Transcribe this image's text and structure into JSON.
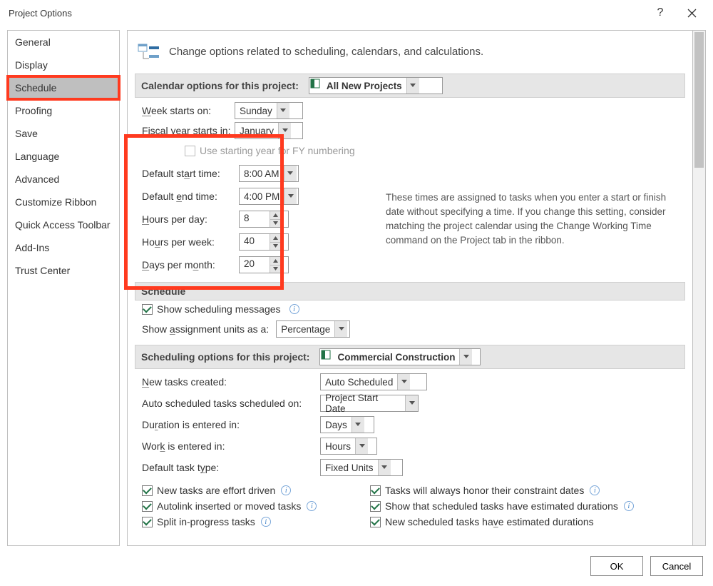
{
  "title": "Project Options",
  "sidebar": {
    "items": [
      {
        "label": "General"
      },
      {
        "label": "Display"
      },
      {
        "label": "Schedule"
      },
      {
        "label": "Proofing"
      },
      {
        "label": "Save"
      },
      {
        "label": "Language"
      },
      {
        "label": "Advanced"
      },
      {
        "label": "Customize Ribbon"
      },
      {
        "label": "Quick Access Toolbar"
      },
      {
        "label": "Add-Ins"
      },
      {
        "label": "Trust Center"
      }
    ],
    "selected": "Schedule"
  },
  "intro": "Change options related to scheduling, calendars, and calculations.",
  "section_calendar": {
    "title": "Calendar options for this project:",
    "project_select": "All New Projects",
    "week_starts_label": "Week starts on:",
    "week_starts": "Sunday",
    "fiscal_starts_label": "Fiscal year starts in:",
    "fiscal_starts": "January",
    "use_starting_year": "Use starting year for FY numbering",
    "default_start_label": "Default start time:",
    "default_start": "8:00 AM",
    "default_end_label": "Default end time:",
    "default_end": "4:00 PM",
    "hours_day_label": "Hours per day:",
    "hours_day": "8",
    "hours_week_label": "Hours per week:",
    "hours_week": "40",
    "days_month_label": "Days per month:",
    "days_month": "20",
    "help": "These times are assigned to tasks when you enter a start or finish date without specifying a time. If you change this setting, consider matching the project calendar using the Change Working Time command on the Project tab in the ribbon."
  },
  "section_schedule": {
    "title": "Schedule",
    "show_msgs": "Show scheduling messages",
    "assign_units_label": "Show assignment units as a:",
    "assign_units": "Percentage"
  },
  "section_schedopt": {
    "title": "Scheduling options for this project:",
    "project_select": "Commercial Construction",
    "new_tasks_label": "New tasks created:",
    "new_tasks": "Auto Scheduled",
    "auto_on_label": "Auto scheduled tasks scheduled on:",
    "auto_on": "Project Start Date",
    "duration_label": "Duration is entered in:",
    "duration": "Days",
    "work_label": "Work is entered in:",
    "work": "Hours",
    "task_type_label": "Default task type:",
    "task_type": "Fixed Units",
    "chk_effort": "New tasks are effort driven",
    "chk_honor": "Tasks will always honor their constraint dates",
    "chk_autolink": "Autolink inserted or moved tasks",
    "chk_show_est": "Show that scheduled tasks have estimated durations",
    "chk_split": "Split in-progress tasks",
    "chk_new_est": "New scheduled tasks have estimated durations"
  },
  "footer": {
    "ok": "OK",
    "cancel": "Cancel"
  }
}
